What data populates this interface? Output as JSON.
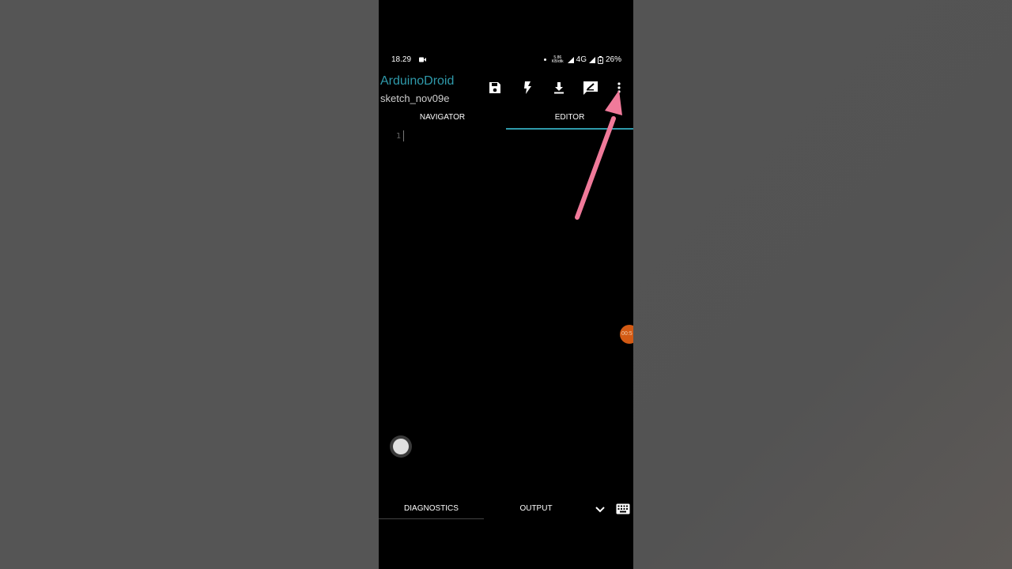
{
  "status_bar": {
    "time": "18.29",
    "net_speed": "5.86\nKB/dtk",
    "network": "4G",
    "battery": "26%"
  },
  "app": {
    "title": "ArduinoDroid",
    "subtitle": "sketch_nov09e",
    "accent_color": "#2f9aab"
  },
  "toolbar": {
    "icons": [
      "save-icon",
      "flash-icon",
      "download-icon",
      "edit-icon",
      "more-vert-icon"
    ]
  },
  "tabs": [
    {
      "label": "NAVIGATOR",
      "active": false
    },
    {
      "label": "EDITOR",
      "active": true
    }
  ],
  "editor": {
    "line_numbers": [
      "1"
    ]
  },
  "floating_timer": {
    "text": "00:5"
  },
  "bottom_tabs": [
    {
      "label": "DIAGNOSTICS"
    },
    {
      "label": "OUTPUT"
    }
  ],
  "annotation": {
    "arrow_color": "#f07a9a"
  }
}
